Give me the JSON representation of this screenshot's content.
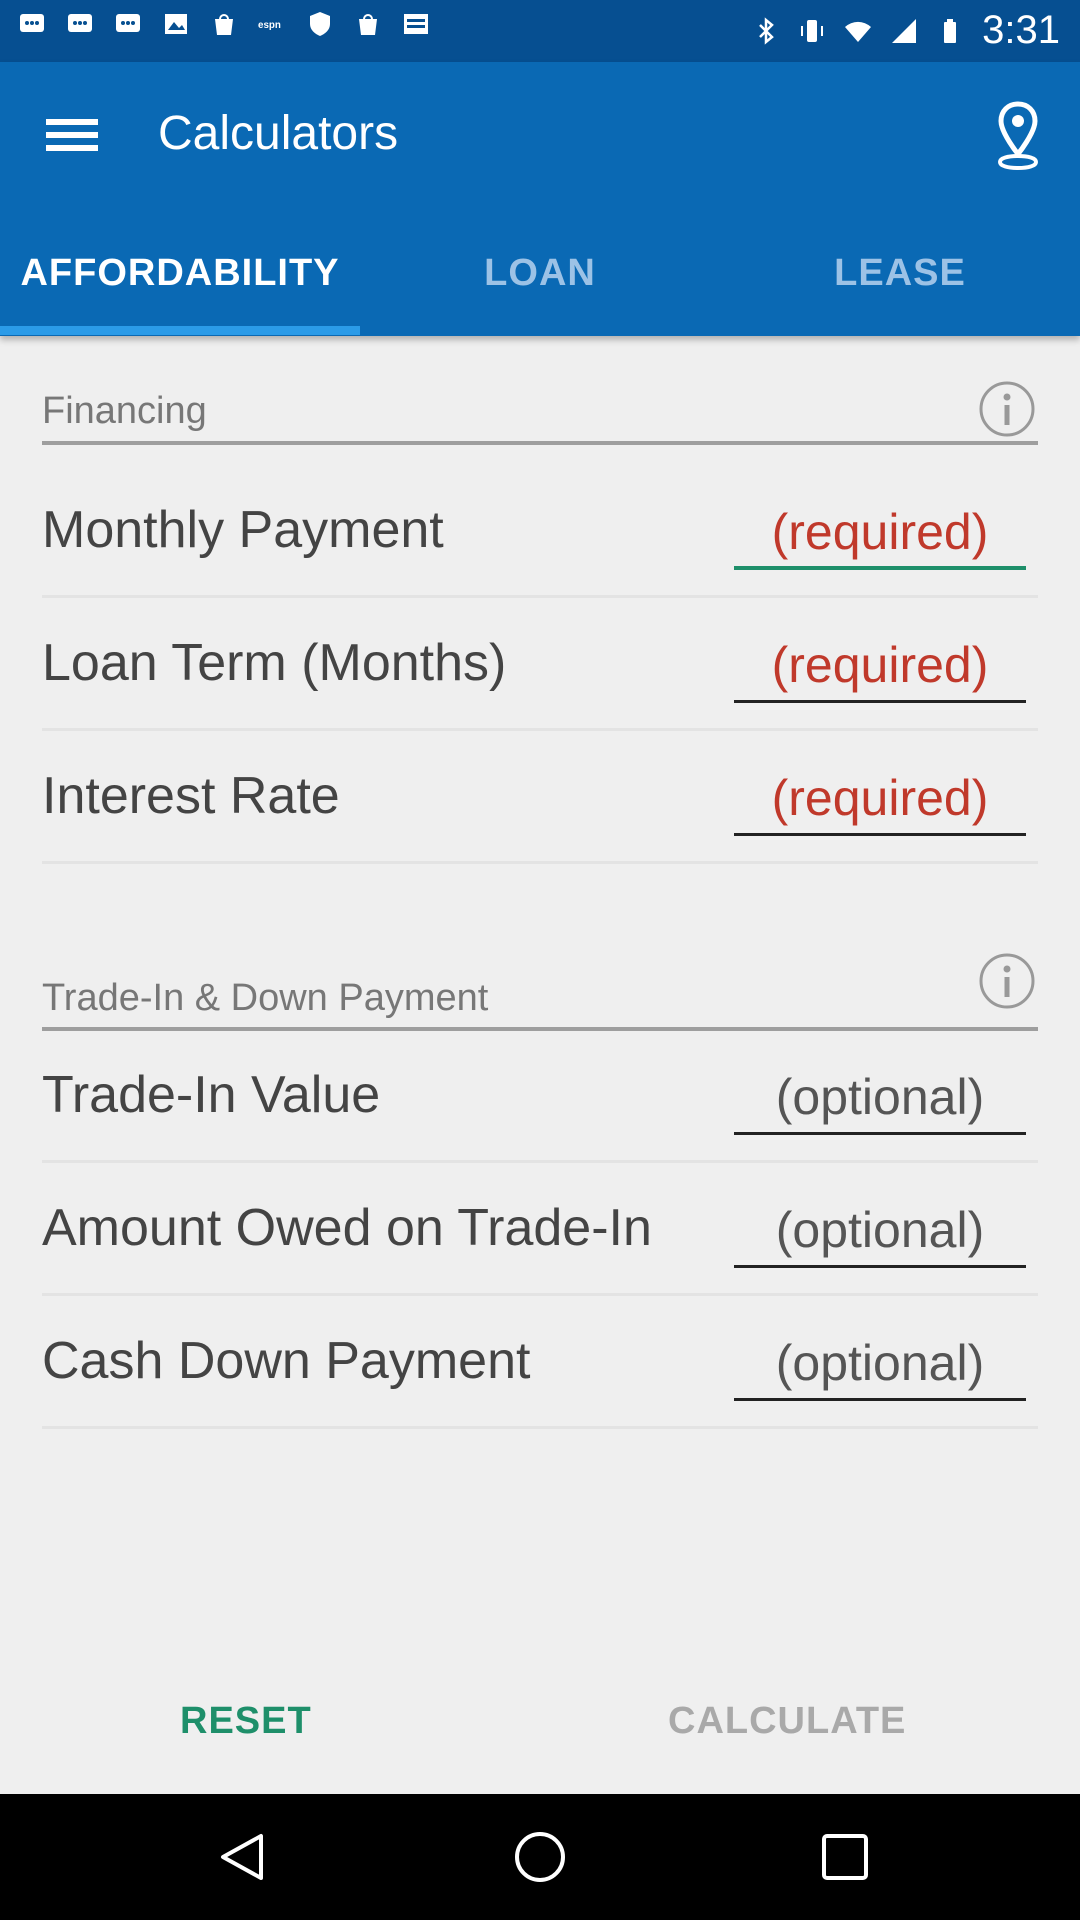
{
  "status_bar": {
    "time": "3:31",
    "icons": [
      "messages-icon",
      "messages-icon",
      "messages-icon",
      "image-icon",
      "bag-icon",
      "espn-icon",
      "shield-icon",
      "bag-icon",
      "espn-dallas-icon",
      "bluetooth-icon",
      "vibrate-icon",
      "wifi-icon",
      "signal-icon",
      "battery-icon"
    ]
  },
  "app_bar": {
    "title": "Calculators",
    "menu_icon": "menu-icon",
    "location_icon": "location-pin-icon"
  },
  "tabs": [
    {
      "label": "AFFORDABILITY",
      "selected": true
    },
    {
      "label": "LOAN",
      "selected": false
    },
    {
      "label": "LEASE",
      "selected": false
    }
  ],
  "financing": {
    "label": "Financing",
    "rows": [
      {
        "label": "Monthly Payment",
        "placeholder": "(required)"
      },
      {
        "label": "Loan Term (Months)",
        "placeholder": "(required)"
      },
      {
        "label": "Interest Rate",
        "placeholder": "(required)"
      }
    ]
  },
  "trade_in": {
    "label": "Trade-In & Down Payment",
    "rows": [
      {
        "label": "Trade-In Value",
        "placeholder": "(optional)"
      },
      {
        "label": "Amount Owed on Trade-In",
        "placeholder": "(optional)"
      },
      {
        "label": "Cash Down Payment",
        "placeholder": "(optional)"
      }
    ]
  },
  "buttons": {
    "reset": "RESET",
    "calculate": "CALCULATE"
  },
  "colors": {
    "status_bar": "#064f91",
    "app_bar": "#0a69b4",
    "tab_indicator": "#2b9be8",
    "required_text": "#c0392b",
    "accent_green": "#1e8f6a",
    "disabled_text": "#a9a9a9"
  }
}
